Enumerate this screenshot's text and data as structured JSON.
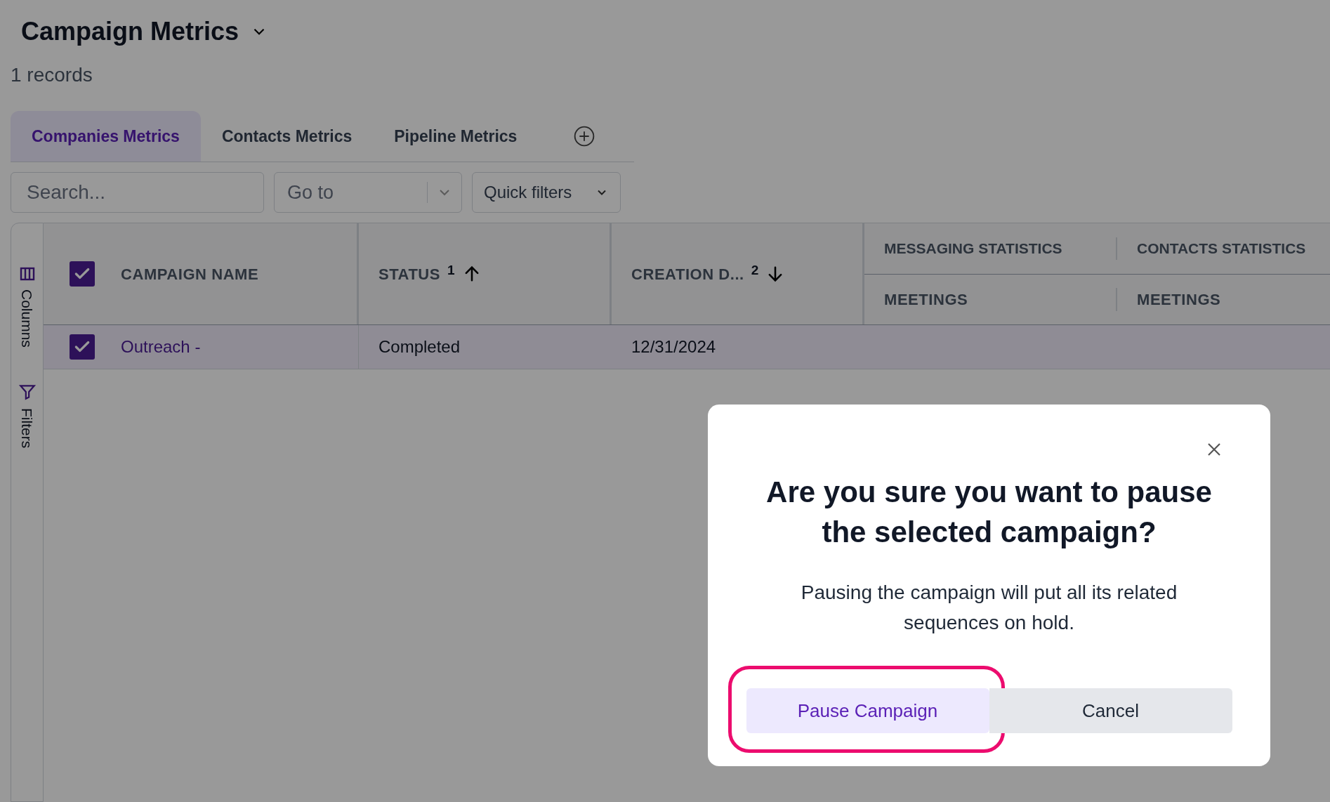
{
  "header": {
    "title": "Campaign Metrics",
    "records": "1 records"
  },
  "tabs": [
    {
      "label": "Companies Metrics",
      "selected": true
    },
    {
      "label": "Contacts Metrics",
      "selected": false
    },
    {
      "label": "Pipeline Metrics",
      "selected": false
    }
  ],
  "toolbar": {
    "search_placeholder": "Search...",
    "goto_placeholder": "Go to",
    "quick_filters": "Quick filters"
  },
  "side_panel": [
    "Columns",
    "Filters"
  ],
  "table": {
    "select_all_checked": true,
    "columns": [
      {
        "label": "CAMPAIGN NAME",
        "kind": "plain"
      },
      {
        "label": "STATUS",
        "sort_order": "1",
        "kind": "ascending"
      },
      {
        "label": "CREATION D...",
        "sort_order": "2",
        "kind": "descending"
      }
    ],
    "groups": [
      {
        "label": "MESSAGING STATISTICS",
        "sub": "MEETINGS"
      },
      {
        "label": "CONTACTS STATISTICS",
        "sub": "MEETINGS"
      }
    ],
    "rows": [
      {
        "checked": true,
        "selected": true,
        "cells": [
          "Outreach -",
          "Completed",
          "12/31/2024"
        ]
      }
    ]
  },
  "modal": {
    "title": "Are you sure you want to pause the selected campaign?",
    "message": "Pausing the campaign will put all its related sequences on hold.",
    "buttons": [
      {
        "label": "Pause Campaign",
        "kind": "primary",
        "highlighted": true
      },
      {
        "label": "Cancel",
        "kind": "secondary",
        "highlighted": false
      }
    ]
  }
}
